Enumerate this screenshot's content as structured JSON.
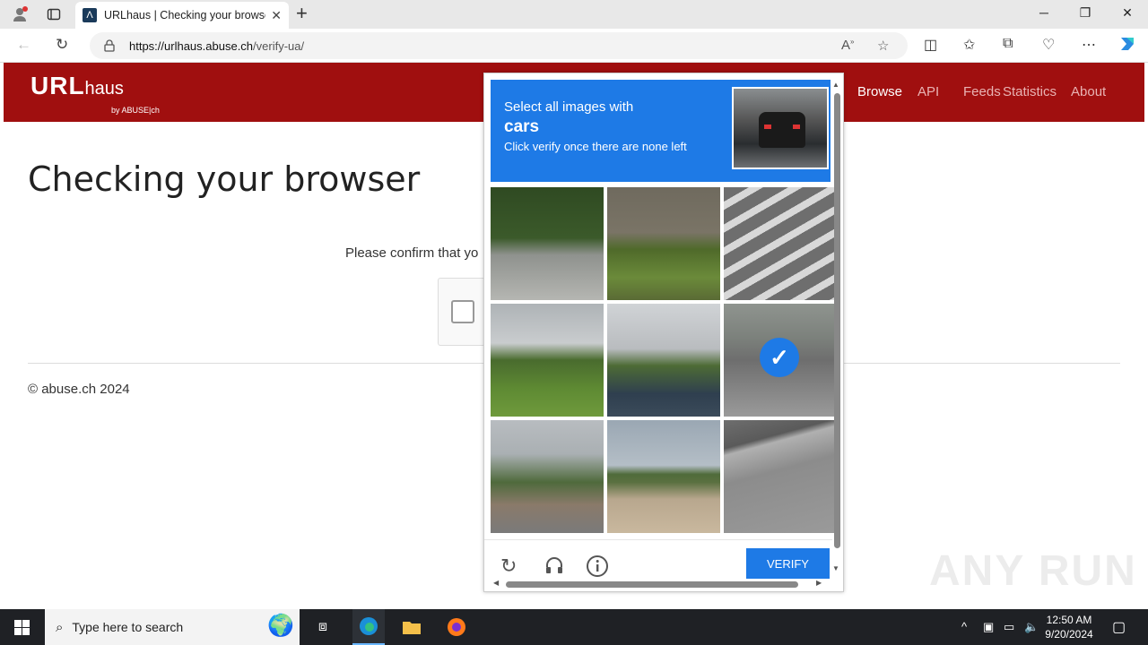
{
  "browser": {
    "tab_title": "URLhaus | Checking your browser",
    "url_domain": "https://urlhaus.abuse.ch",
    "url_path": "/verify-ua/"
  },
  "site": {
    "logo_main": "URL",
    "logo_sub": "haus",
    "logo_by": "by ABUSE|ch",
    "nav": [
      "Browse",
      "API",
      "Feeds",
      "Statistics",
      "About"
    ],
    "heading": "Checking your browser",
    "confirm_text": "Please confirm that yo",
    "copyright": "© abuse.ch 2024"
  },
  "captcha": {
    "line1": "Select all images with",
    "target": "cars",
    "line3": "Click verify once there are none left",
    "verify_label": "VERIFY",
    "selected_tile": 5
  },
  "watermark": "ANY RUN",
  "taskbar": {
    "search_placeholder": "Type here to search",
    "time": "12:50 AM",
    "date": "9/20/2024"
  },
  "colors": {
    "brand_red": "#a00f0f",
    "captcha_blue": "#1e7ae6"
  }
}
